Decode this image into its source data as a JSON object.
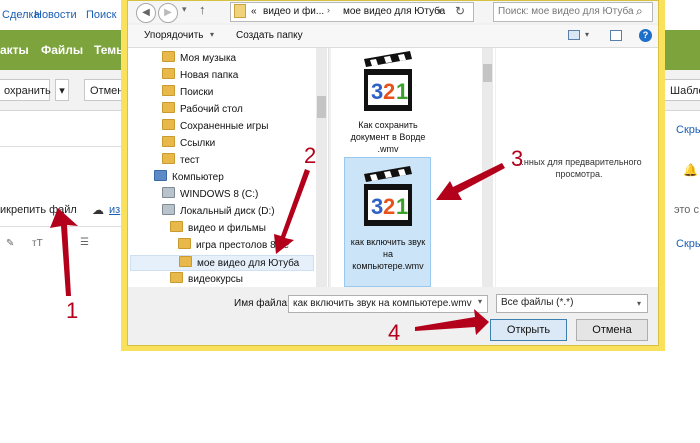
{
  "background_app": {
    "top_links": [
      "Сделка",
      "Новости",
      "Поиск"
    ],
    "menu": [
      "акты",
      "Файлы",
      "Темы"
    ],
    "toolbar": {
      "save": "охранить",
      "cancel": "Отмена",
      "templates": "Шаблон"
    },
    "attach_link": "икрепить файл",
    "cloud_label": "из",
    "right_links": [
      "Скры",
      "это с",
      "Скры"
    ],
    "format_labels": [
      "тТ"
    ]
  },
  "dialog": {
    "breadcrumb": [
      "«",
      "видео и фи...",
      "мое видео для Ютуба"
    ],
    "search_placeholder": "Поиск: мое видео для Ютуба",
    "organize": "Упорядочить",
    "new_folder": "Создать папку",
    "tree": [
      "Моя музыка",
      "Новая папка",
      "Поиски",
      "Рабочий стол",
      "Сохраненные игры",
      "Ссылки",
      "тест",
      "Компьютер",
      "WINDOWS 8 (C:)",
      "Локальный диск (D:)",
      "видео и фильмы",
      "игра престолов 8 се",
      "мое видео для Ютуба",
      "видеокурсы"
    ],
    "files": [
      {
        "name": "Как  сохранить документ в Ворде .wmv",
        "icon_text": "321"
      },
      {
        "name": "как включить звук на компьютере.wmv",
        "icon_text": "321",
        "selected": true
      }
    ],
    "preview_text": "...нных для предварительного просмотра.",
    "filename_label": "Имя файла:",
    "filename_value": "как включить звук на компьютере.wmv",
    "filetype_value": "Все файлы (*.*)",
    "open_button": "Открыть",
    "cancel_button": "Отмена"
  },
  "annotations": [
    "1",
    "2",
    "3",
    "4"
  ],
  "colors": {
    "dialog_frame": "#f9e15c",
    "arrow": "#b3001b",
    "green_bar": "#7ca33c",
    "selection": "#cce4f7"
  }
}
